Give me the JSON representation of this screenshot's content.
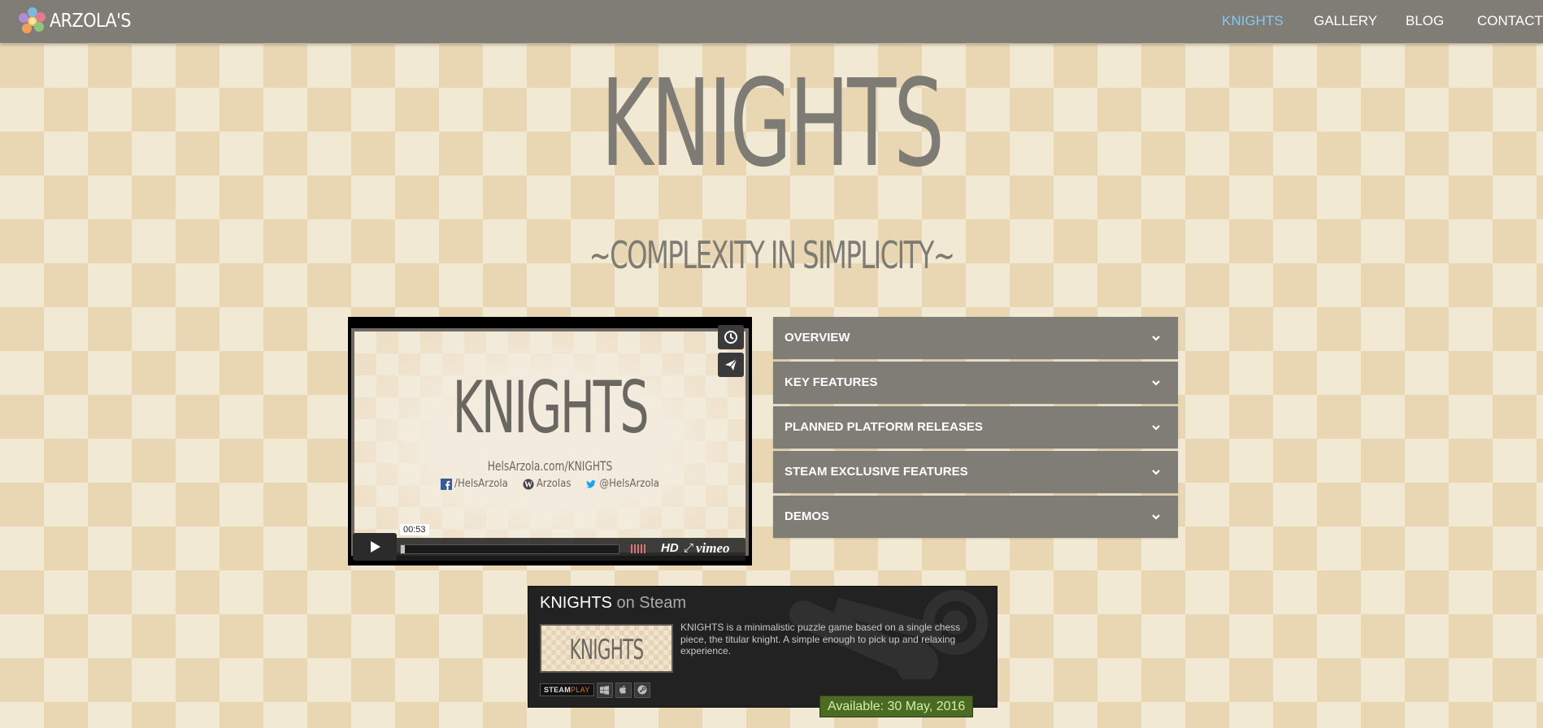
{
  "nav": {
    "brand": "ARZOLA'S",
    "items": [
      {
        "label": "KNIGHTS",
        "active": true
      },
      {
        "label": "GALLERY",
        "active": false
      },
      {
        "label": "BLOG",
        "active": false
      },
      {
        "label": "CONTACT",
        "active": false
      }
    ]
  },
  "hero": {
    "title": "KNIGHTS",
    "subtitle": "~COMPLEXITY IN SIMPLICITY~"
  },
  "video": {
    "title": "KNIGHTS",
    "url": "HelsArzola.com/KNIGHTS",
    "social": [
      {
        "icon": "facebook-icon",
        "label": "/HelsArzola"
      },
      {
        "icon": "wordpress-icon",
        "label": "Arzolas"
      },
      {
        "icon": "twitter-icon",
        "label": "@HelsArzola"
      }
    ],
    "timecode": "00:53",
    "progress": 0.02,
    "hd_label": "HD",
    "provider_label": "vimeo"
  },
  "accordion": {
    "items": [
      {
        "label": "OVERVIEW"
      },
      {
        "label": "KEY FEATURES"
      },
      {
        "label": "PLANNED PLATFORM RELEASES"
      },
      {
        "label": "STEAM EXCLUSIVE FEATURES"
      },
      {
        "label": "DEMOS"
      }
    ]
  },
  "steam": {
    "game": "KNIGHTS",
    "on_steam": "on Steam",
    "capsule_text": "KNIGHTS",
    "description": "KNIGHTS is a minimalistic puzzle game based on a single chess piece, the titular knight. A simple enough to pick up and relaxing experience.",
    "steamplay_label": "STEAM",
    "steamplay_suffix": "PLAY",
    "platforms": [
      "windows-icon",
      "apple-icon",
      "steam-icon"
    ],
    "availability": "Available: 30 May, 2016"
  },
  "colors": {
    "navbar": "#807d76",
    "nav_active": "#8ec5ea",
    "text_muted": "#7e7b74",
    "available_bg": "#4c6b22"
  }
}
